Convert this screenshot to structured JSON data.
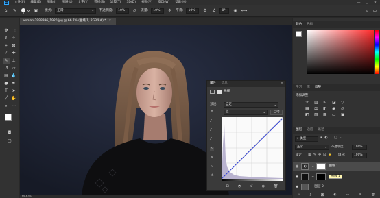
{
  "app": {
    "menu": [
      "文件(F)",
      "编辑(E)",
      "图像(I)",
      "图层(L)",
      "文字(Y)",
      "选择(S)",
      "滤镜(T)",
      "3D(D)",
      "视图(V)",
      "窗口(W)",
      "帮助(H)"
    ],
    "logo": "Ps",
    "window_controls": [
      "—",
      "□",
      "✕"
    ]
  },
  "options_bar": {
    "brush_size": "5",
    "mode_label": "模式:",
    "mode_value": "正常",
    "opacity_label": "不透明度:",
    "opacity_value": "10%",
    "flow_label": "流量:",
    "flow_value": "10%",
    "smooth_label": "平滑:",
    "smooth_value": "10%",
    "angle_value": "0°"
  },
  "document": {
    "tab_title": "woman-2998996_1920.jpg @ 66.7% (曲线 1, RGB/8#) *",
    "zoom": "66.67%"
  },
  "color_panel": {
    "tabs": [
      "颜色",
      "色板"
    ],
    "fg_color": "#ffffff",
    "bg_color": "#000000"
  },
  "adjust_panel": {
    "tabs": [
      "学习",
      "库",
      "调整"
    ],
    "title": "添加调整"
  },
  "layers_panel": {
    "tabs": [
      "图层",
      "通道",
      "路径"
    ],
    "filter_label": "类型",
    "blend_mode": "正常",
    "opacity_label": "不透明度:",
    "opacity_value": "100%",
    "lock_label": "锁定:",
    "fill_label": "填充:",
    "fill_value": "100%",
    "layers": [
      {
        "name": "曲线 1",
        "tooltip": "曲线 1"
      },
      {
        "name": "图层 2"
      }
    ]
  },
  "properties_panel": {
    "tabs": [
      "属性",
      "信息"
    ],
    "type_label": "曲线",
    "preset_label": "预设:",
    "preset_value": "自定",
    "channel_value": "蓝",
    "auto_button": "自动"
  },
  "colors": {
    "accent": "#31a8ff",
    "panel": "#323232",
    "canvas_bg": "#1b2233"
  }
}
